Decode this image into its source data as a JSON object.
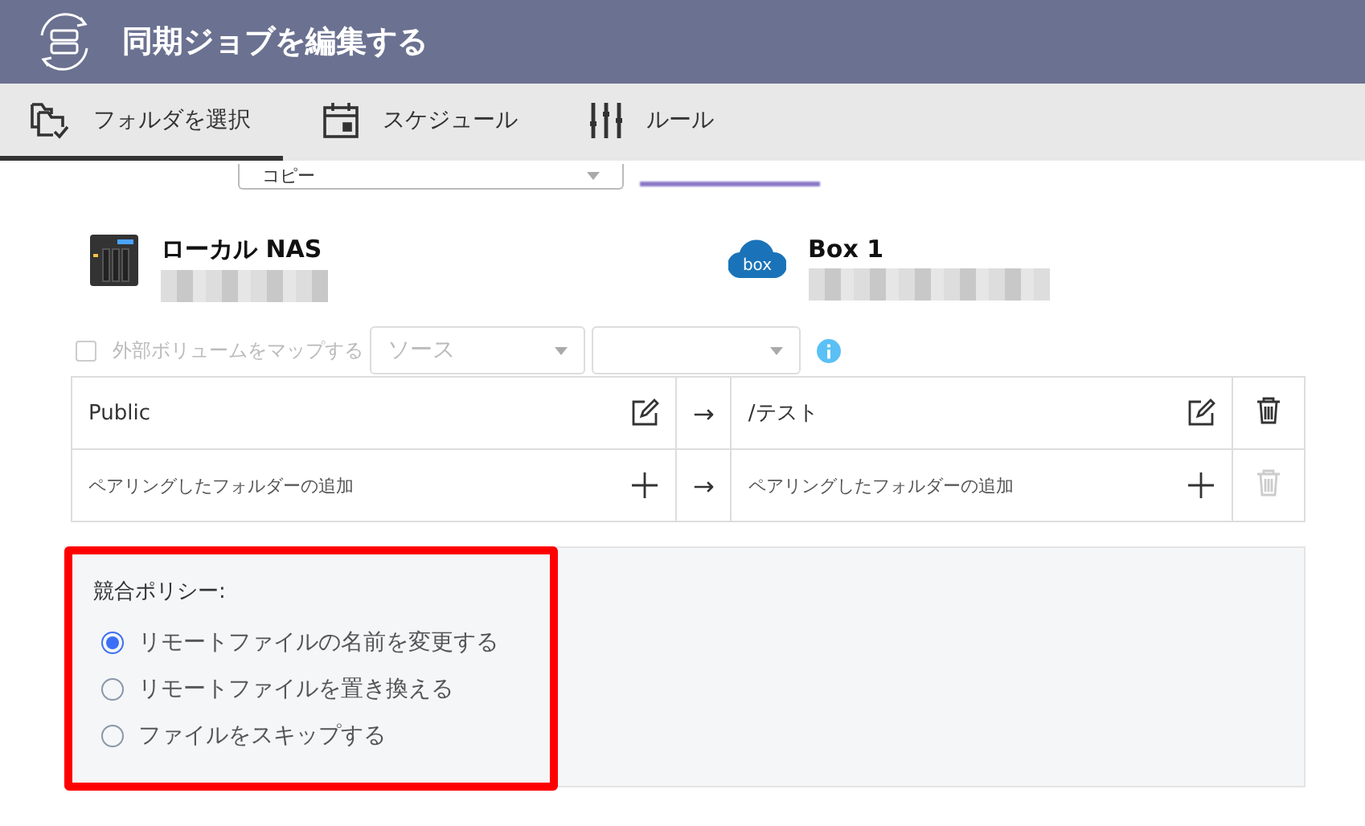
{
  "window": {
    "title": "同期ジョブを編集する"
  },
  "tabs": [
    {
      "label": "フォルダを選択",
      "selected": true,
      "kind": "folder"
    },
    {
      "label": "スケジュール",
      "selected": false,
      "kind": "calendar"
    },
    {
      "label": "ルール",
      "selected": false,
      "kind": "sliders"
    }
  ],
  "sync_mode": {
    "value": "コピー"
  },
  "endpoints": [
    {
      "name": "ローカル NAS",
      "kind": "nas"
    },
    {
      "name": "Box 1",
      "kind": "box"
    }
  ],
  "map_volume": {
    "label": "外部ボリュームをマップする",
    "checked": false,
    "disabled": true,
    "source_placeholder": "ソース"
  },
  "pairs": [
    {
      "source": "Public",
      "arrow": "→",
      "target": "/テスト",
      "kind": "pair"
    },
    {
      "source": "ペアリングしたフォルダーの追加",
      "arrow": "→",
      "target": "ペアリングしたフォルダーの追加",
      "kind": "add"
    }
  ],
  "conflict_policy": {
    "label": "競合ポリシー:",
    "options": [
      {
        "label": "リモートファイルの名前を変更する",
        "selected": true
      },
      {
        "label": "リモートファイルを置き換える",
        "selected": false
      },
      {
        "label": "ファイルをスキップする",
        "selected": false
      }
    ]
  }
}
